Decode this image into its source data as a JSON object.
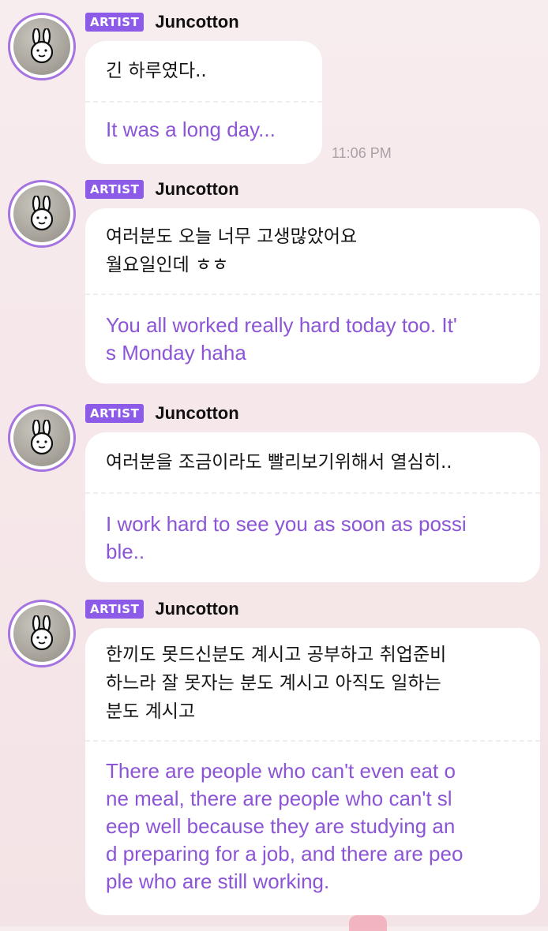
{
  "messages": [
    {
      "badge": "ARTIST",
      "author": "Juncotton",
      "korean": "긴 하루였다..",
      "english": "It was a long day...",
      "time": "11:06 PM"
    },
    {
      "badge": "ARTIST",
      "author": "Juncotton",
      "korean": "여러분도 오늘 너무 고생많았어요\n월요일인데 ㅎㅎ",
      "english": "You all worked really hard today too. It'\ns Monday haha"
    },
    {
      "badge": "ARTIST",
      "author": "Juncotton",
      "korean": "여러분을 조금이라도 빨리보기위해서 열심히..",
      "english": "I work hard to see you as soon as possi\nble.."
    },
    {
      "badge": "ARTIST",
      "author": "Juncotton",
      "korean": "한끼도 못드신분도 계시고 공부하고 취업준비\n하느라 잘 못자는 분도 계시고 아직도 일하는\n분도 계시고",
      "english": "There are people who can't even eat o\nne meal, there are people who can't sl\neep well because they are studying an\nd preparing for a job, and there are peo\nple who are still working."
    }
  ],
  "colors": {
    "accent": "#8c5be8",
    "translation_text": "#8c55d6",
    "background": "#f6e8ea"
  },
  "icons": {
    "avatar": "bunny-avatar-icon"
  }
}
